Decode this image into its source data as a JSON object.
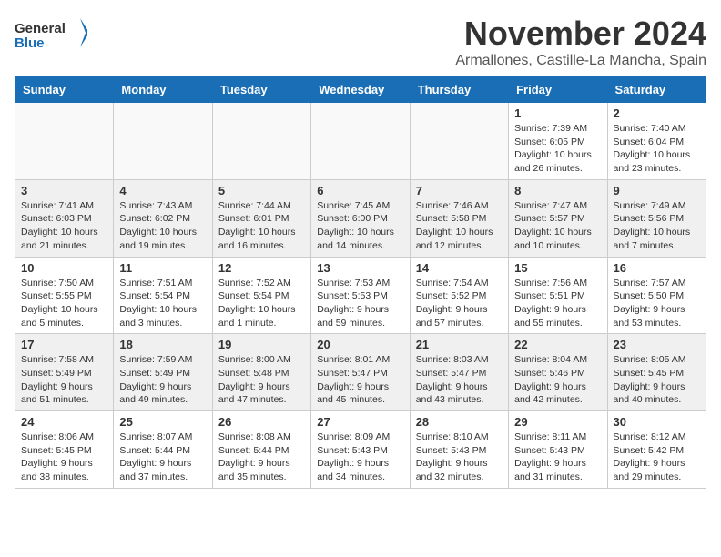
{
  "header": {
    "logo_general": "General",
    "logo_blue": "Blue",
    "month": "November 2024",
    "location": "Armallones, Castille-La Mancha, Spain"
  },
  "weekdays": [
    "Sunday",
    "Monday",
    "Tuesday",
    "Wednesday",
    "Thursday",
    "Friday",
    "Saturday"
  ],
  "weeks": [
    {
      "shaded": false,
      "days": [
        {
          "number": "",
          "info": ""
        },
        {
          "number": "",
          "info": ""
        },
        {
          "number": "",
          "info": ""
        },
        {
          "number": "",
          "info": ""
        },
        {
          "number": "",
          "info": ""
        },
        {
          "number": "1",
          "info": "Sunrise: 7:39 AM\nSunset: 6:05 PM\nDaylight: 10 hours and 26 minutes."
        },
        {
          "number": "2",
          "info": "Sunrise: 7:40 AM\nSunset: 6:04 PM\nDaylight: 10 hours and 23 minutes."
        }
      ]
    },
    {
      "shaded": true,
      "days": [
        {
          "number": "3",
          "info": "Sunrise: 7:41 AM\nSunset: 6:03 PM\nDaylight: 10 hours and 21 minutes."
        },
        {
          "number": "4",
          "info": "Sunrise: 7:43 AM\nSunset: 6:02 PM\nDaylight: 10 hours and 19 minutes."
        },
        {
          "number": "5",
          "info": "Sunrise: 7:44 AM\nSunset: 6:01 PM\nDaylight: 10 hours and 16 minutes."
        },
        {
          "number": "6",
          "info": "Sunrise: 7:45 AM\nSunset: 6:00 PM\nDaylight: 10 hours and 14 minutes."
        },
        {
          "number": "7",
          "info": "Sunrise: 7:46 AM\nSunset: 5:58 PM\nDaylight: 10 hours and 12 minutes."
        },
        {
          "number": "8",
          "info": "Sunrise: 7:47 AM\nSunset: 5:57 PM\nDaylight: 10 hours and 10 minutes."
        },
        {
          "number": "9",
          "info": "Sunrise: 7:49 AM\nSunset: 5:56 PM\nDaylight: 10 hours and 7 minutes."
        }
      ]
    },
    {
      "shaded": false,
      "days": [
        {
          "number": "10",
          "info": "Sunrise: 7:50 AM\nSunset: 5:55 PM\nDaylight: 10 hours and 5 minutes."
        },
        {
          "number": "11",
          "info": "Sunrise: 7:51 AM\nSunset: 5:54 PM\nDaylight: 10 hours and 3 minutes."
        },
        {
          "number": "12",
          "info": "Sunrise: 7:52 AM\nSunset: 5:54 PM\nDaylight: 10 hours and 1 minute."
        },
        {
          "number": "13",
          "info": "Sunrise: 7:53 AM\nSunset: 5:53 PM\nDaylight: 9 hours and 59 minutes."
        },
        {
          "number": "14",
          "info": "Sunrise: 7:54 AM\nSunset: 5:52 PM\nDaylight: 9 hours and 57 minutes."
        },
        {
          "number": "15",
          "info": "Sunrise: 7:56 AM\nSunset: 5:51 PM\nDaylight: 9 hours and 55 minutes."
        },
        {
          "number": "16",
          "info": "Sunrise: 7:57 AM\nSunset: 5:50 PM\nDaylight: 9 hours and 53 minutes."
        }
      ]
    },
    {
      "shaded": true,
      "days": [
        {
          "number": "17",
          "info": "Sunrise: 7:58 AM\nSunset: 5:49 PM\nDaylight: 9 hours and 51 minutes."
        },
        {
          "number": "18",
          "info": "Sunrise: 7:59 AM\nSunset: 5:49 PM\nDaylight: 9 hours and 49 minutes."
        },
        {
          "number": "19",
          "info": "Sunrise: 8:00 AM\nSunset: 5:48 PM\nDaylight: 9 hours and 47 minutes."
        },
        {
          "number": "20",
          "info": "Sunrise: 8:01 AM\nSunset: 5:47 PM\nDaylight: 9 hours and 45 minutes."
        },
        {
          "number": "21",
          "info": "Sunrise: 8:03 AM\nSunset: 5:47 PM\nDaylight: 9 hours and 43 minutes."
        },
        {
          "number": "22",
          "info": "Sunrise: 8:04 AM\nSunset: 5:46 PM\nDaylight: 9 hours and 42 minutes."
        },
        {
          "number": "23",
          "info": "Sunrise: 8:05 AM\nSunset: 5:45 PM\nDaylight: 9 hours and 40 minutes."
        }
      ]
    },
    {
      "shaded": false,
      "days": [
        {
          "number": "24",
          "info": "Sunrise: 8:06 AM\nSunset: 5:45 PM\nDaylight: 9 hours and 38 minutes."
        },
        {
          "number": "25",
          "info": "Sunrise: 8:07 AM\nSunset: 5:44 PM\nDaylight: 9 hours and 37 minutes."
        },
        {
          "number": "26",
          "info": "Sunrise: 8:08 AM\nSunset: 5:44 PM\nDaylight: 9 hours and 35 minutes."
        },
        {
          "number": "27",
          "info": "Sunrise: 8:09 AM\nSunset: 5:43 PM\nDaylight: 9 hours and 34 minutes."
        },
        {
          "number": "28",
          "info": "Sunrise: 8:10 AM\nSunset: 5:43 PM\nDaylight: 9 hours and 32 minutes."
        },
        {
          "number": "29",
          "info": "Sunrise: 8:11 AM\nSunset: 5:43 PM\nDaylight: 9 hours and 31 minutes."
        },
        {
          "number": "30",
          "info": "Sunrise: 8:12 AM\nSunset: 5:42 PM\nDaylight: 9 hours and 29 minutes."
        }
      ]
    }
  ]
}
